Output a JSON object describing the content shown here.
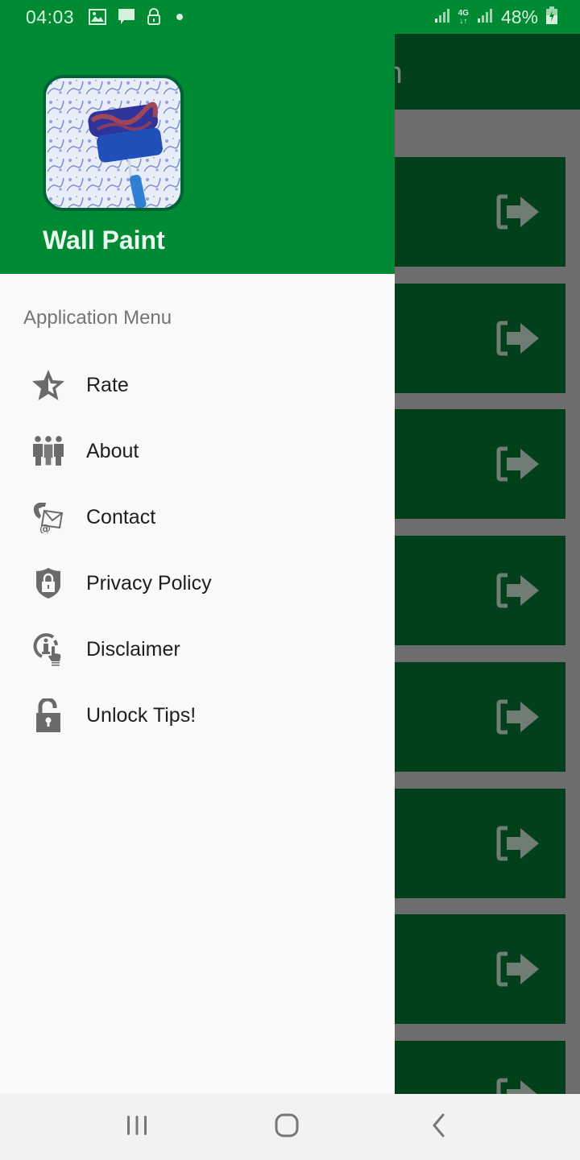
{
  "status_bar": {
    "time": "04:03",
    "left_icons": [
      "gallery-icon",
      "message-icon",
      "lock-icon",
      "dot-icon"
    ],
    "network_label_top": "4G",
    "battery_percent": "48%"
  },
  "background_app": {
    "title_fragment": "sign",
    "card_count": 8,
    "card_icon": "enter-arrow-icon"
  },
  "drawer": {
    "app_name": "Wall Paint",
    "menu_heading": "Application Menu",
    "items": [
      {
        "label": "Rate",
        "icon": "star-icon"
      },
      {
        "label": "About",
        "icon": "people-icon"
      },
      {
        "label": "Contact",
        "icon": "contact-icon"
      },
      {
        "label": "Privacy Policy",
        "icon": "shield-lock-icon"
      },
      {
        "label": "Disclaimer",
        "icon": "info-touch-icon"
      },
      {
        "label": "Unlock Tips!",
        "icon": "unlock-icon"
      }
    ]
  },
  "nav_bar": {
    "buttons": [
      "recent-apps",
      "home",
      "back"
    ]
  },
  "colors": {
    "primary": "#008a34",
    "dimmed_primary": "#02401b",
    "scrim": "#6d6d6d",
    "icon_gray": "#6b6b6b"
  }
}
